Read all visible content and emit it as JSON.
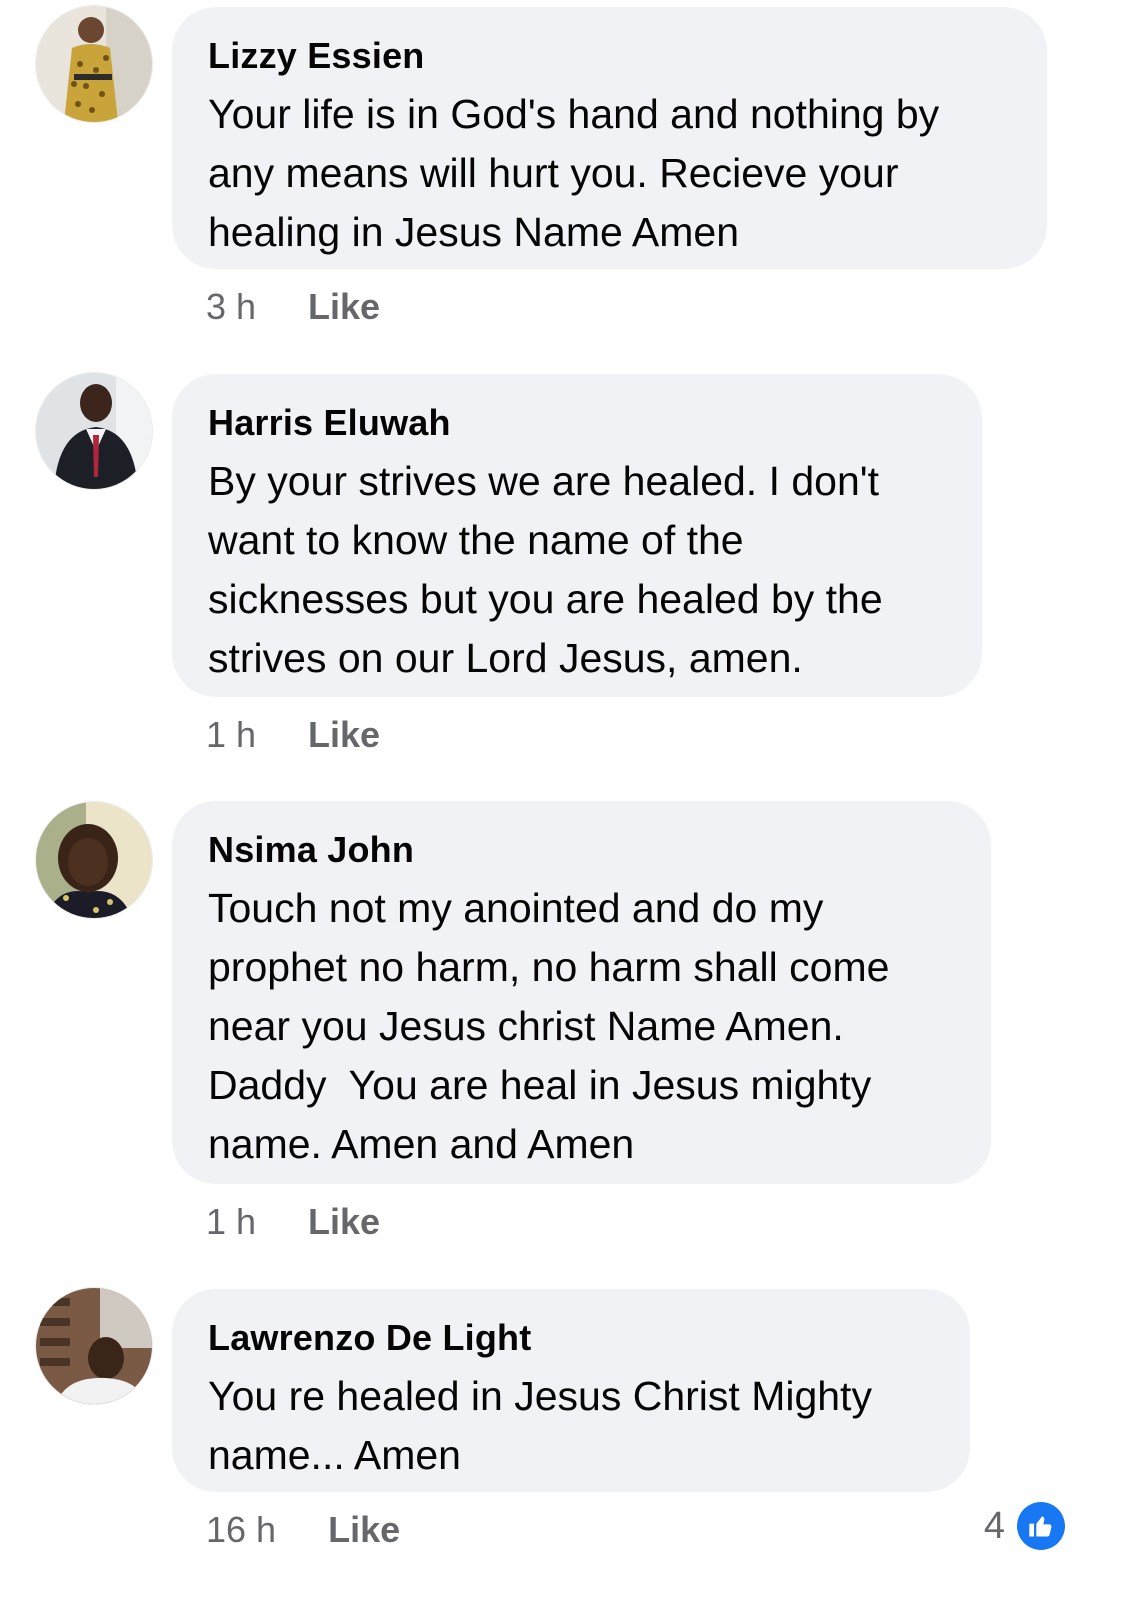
{
  "comments": [
    {
      "author": "Lizzy Essien",
      "text": "Your life is in God's hand and nothing by\nany means will hurt you. Recieve your\nhealing in Jesus Name Amen",
      "time": "3 h",
      "like_label": "Like"
    },
    {
      "author": "Harris Eluwah",
      "text": "By your strives we are healed. I don't\nwant to know the name of the\nsicknesses but you are healed by the\nstrives on our Lord Jesus, amen.",
      "time": "1 h",
      "like_label": "Like"
    },
    {
      "author": "Nsima John",
      "text": "Touch not my anointed and do my\nprophet no harm, no harm shall come\nnear you Jesus christ Name Amen.\nDaddy  You are heal in Jesus mighty\nname. Amen and Amen",
      "time": "1 h",
      "like_label": "Like"
    },
    {
      "author": "Lawrenzo De Light",
      "text": "You re healed in Jesus Christ Mighty\nname... Amen",
      "time": "16 h",
      "like_label": "Like",
      "reaction_count": "4",
      "reaction_icon": "thumbs-up-icon"
    }
  ],
  "colors": {
    "bubble": "#f0f2f5",
    "meta": "#65676b",
    "like_blue": "#1877f2"
  }
}
